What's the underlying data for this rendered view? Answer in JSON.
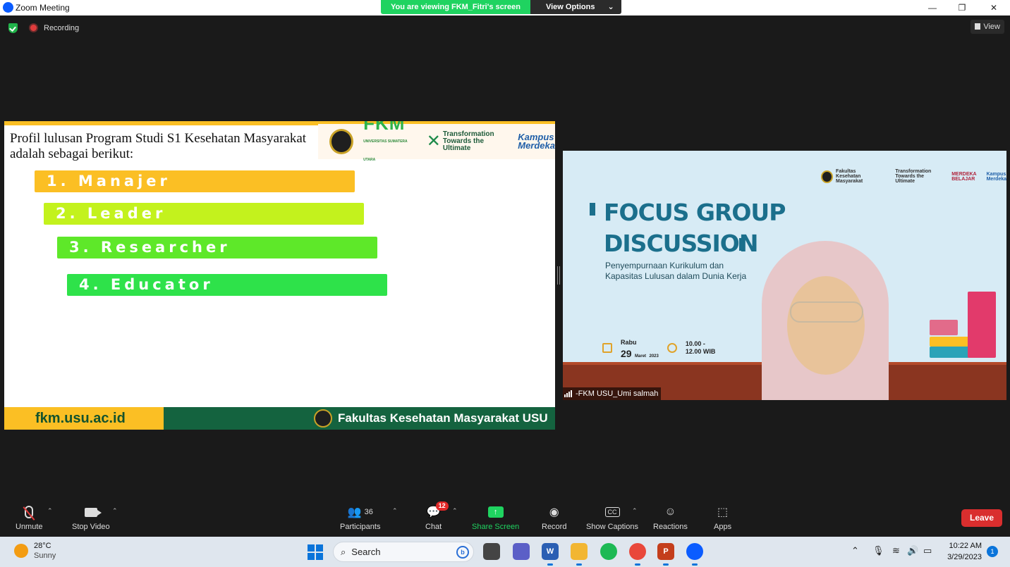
{
  "window": {
    "title": "Zoom Meeting",
    "viewing_banner": "You are viewing FKM_Fitri's screen",
    "view_options": "View Options"
  },
  "status": {
    "recording": "Recording",
    "view": "View"
  },
  "slide": {
    "heading": "Profil lulusan Program Studi S1 Kesehatan Masyarakat adalah sebagai berikut:",
    "logo_fkm": "FKM",
    "logo_fkm_sub": "UNIVERSITAS SUMATERA UTARA",
    "logo_transformation_1": "Transformation",
    "logo_transformation_2": "Towards the Ultimate",
    "logo_kampus_1": "Kampus",
    "logo_kampus_2": "Merdeka",
    "items": [
      {
        "label": "1. Manajer",
        "color": "#fbbf24"
      },
      {
        "label": "2. Leader",
        "color": "#c3f21d"
      },
      {
        "label": "3. Researcher",
        "color": "#5ee829"
      },
      {
        "label": "4. Educator",
        "color": "#2ee24a"
      }
    ],
    "footer_url": "fkm.usu.ac.id",
    "footer_faculty": "Fakultas Kesehatan Masyarakat USU"
  },
  "video": {
    "logo_faculty_1": "Fakultas",
    "logo_faculty_2": "Kesehatan Masyarakat",
    "logo_transformation_1": "Transformation",
    "logo_transformation_2": "Towards the Ultimate",
    "logo_merdeka_1": "MERDEKA",
    "logo_merdeka_2": "BELAJAR",
    "logo_kampus_1": "Kampus",
    "logo_kampus_2": "Merdeka",
    "title_line1": "FOCUS GROUP",
    "title_line2": "DISCUSSION",
    "subtitle_line1": "Penyempurnaan Kurikulum dan",
    "subtitle_line2": "Kapasitas Lulusan dalam Dunia Kerja",
    "day": "Rabu",
    "date_num": "29",
    "month": "Maret",
    "year": "2023",
    "time_line1": "10.00 -",
    "time_line2": "12.00 WIB",
    "participant_name": "-FKM USU_Umi salmah"
  },
  "toolbar": {
    "unmute": "Unmute",
    "stop_video": "Stop Video",
    "participants": "Participants",
    "participants_count": "36",
    "chat": "Chat",
    "chat_badge": "12",
    "share_screen": "Share Screen",
    "record": "Record",
    "cc_icon": "CC",
    "show_captions": "Show Captions",
    "reactions": "Reactions",
    "apps": "Apps",
    "leave": "Leave"
  },
  "taskbar": {
    "temperature": "28°C",
    "condition": "Sunny",
    "search": "Search",
    "time": "10:22 AM",
    "date": "3/29/2023",
    "notifications": "1"
  }
}
